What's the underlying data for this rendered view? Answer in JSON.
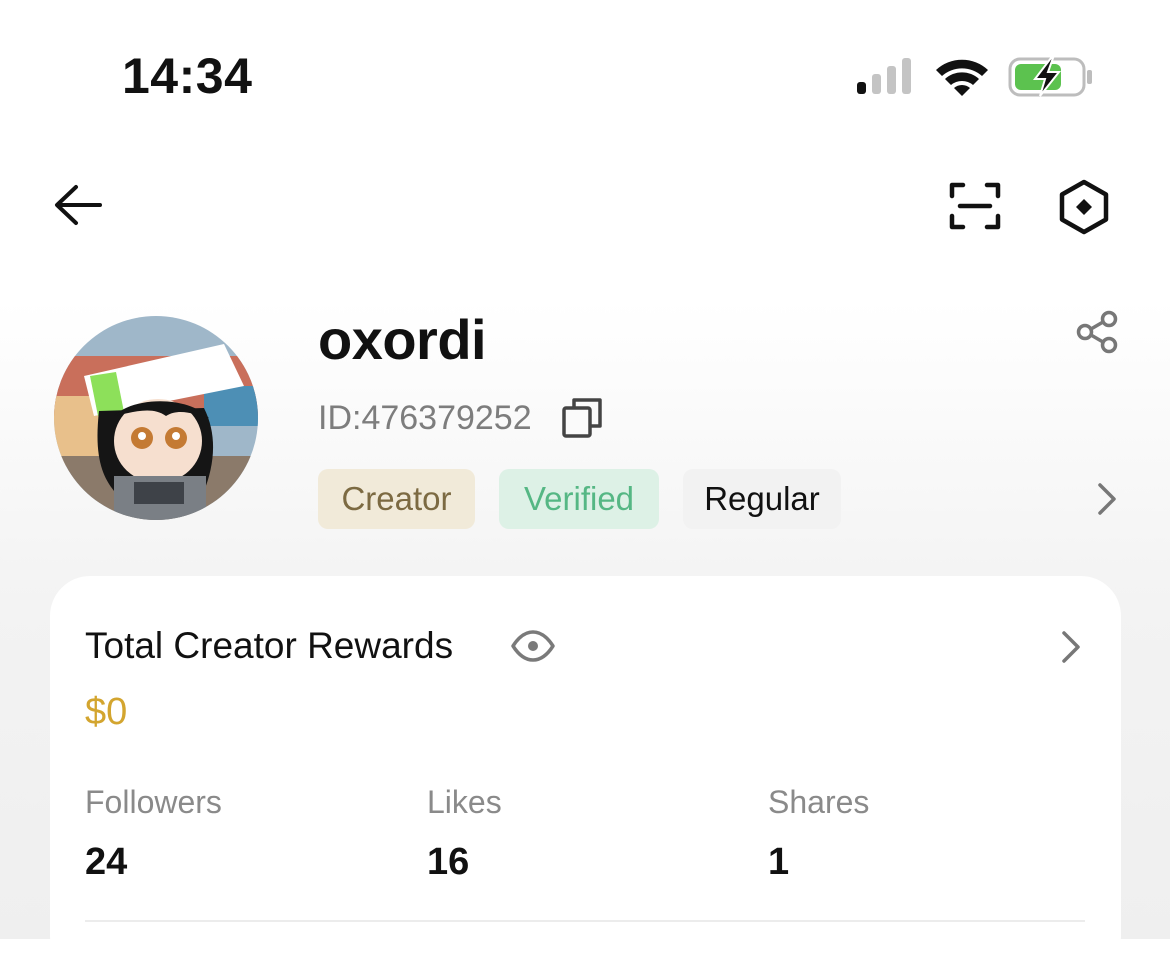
{
  "status_bar": {
    "time": "14:34"
  },
  "nav": {
    "back_icon": "arrow-left-icon",
    "scan_icon": "scan-icon",
    "settings_icon": "hexagon-icon"
  },
  "profile": {
    "username": "oxordi",
    "id_text": "ID:476379252",
    "badges": [
      {
        "label": "Creator",
        "color": "#7c6a42",
        "bg": "#f1ead9"
      },
      {
        "label": "Verified",
        "color": "#55b784",
        "bg": "#ddf1e6"
      },
      {
        "label": "Regular",
        "color": "#111111",
        "bg": "#f2f2f2"
      }
    ]
  },
  "rewards": {
    "title": "Total Creator Rewards",
    "value": "$0",
    "value_color": "#d3a52f"
  },
  "stats": [
    {
      "label": "Followers",
      "value": "24"
    },
    {
      "label": "Likes",
      "value": "16"
    },
    {
      "label": "Shares",
      "value": "1"
    }
  ]
}
